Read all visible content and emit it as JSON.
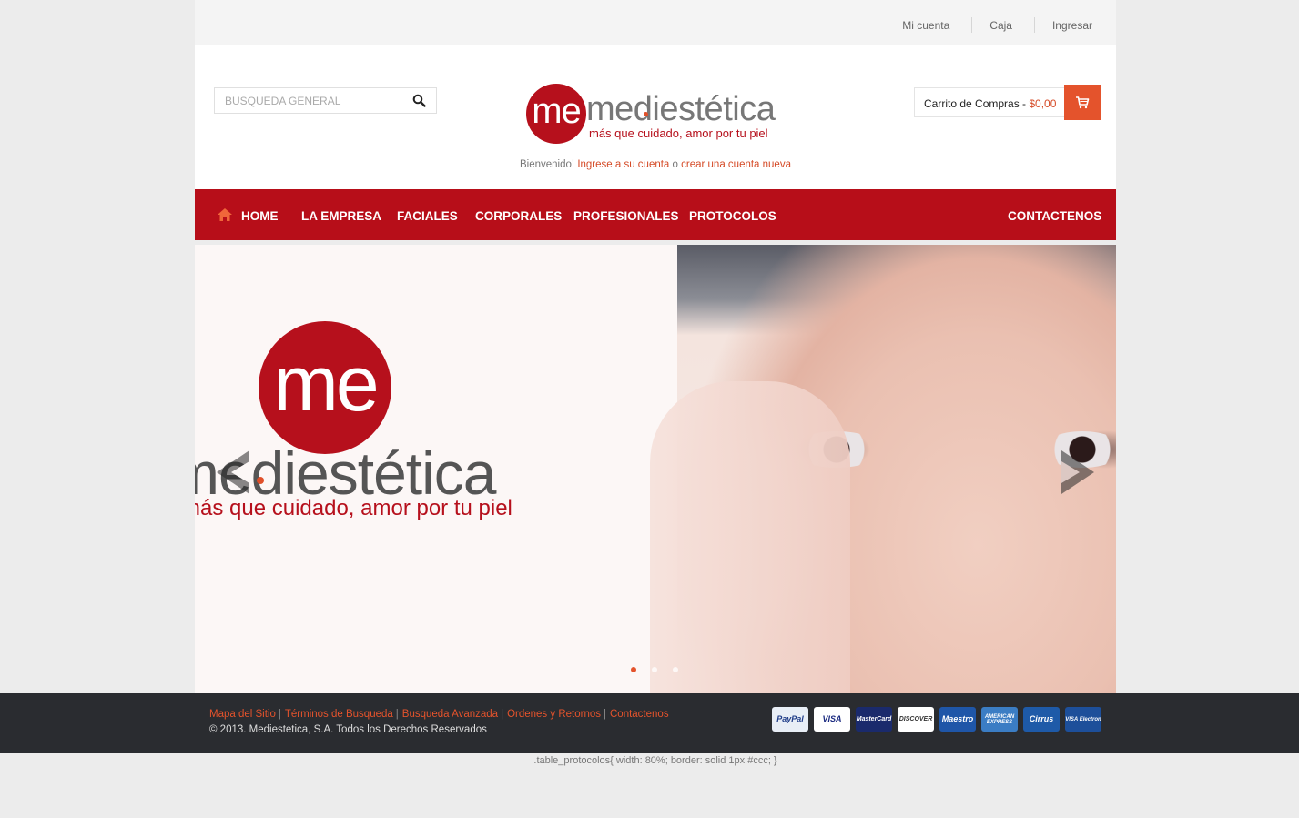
{
  "topbar": {
    "links": [
      "Mi cuenta",
      "Caja",
      "Ingresar"
    ]
  },
  "search": {
    "placeholder": "BUSQUEDA GENERAL"
  },
  "logo": {
    "mark": "me",
    "name": "mediestética",
    "tagline": "más que cuidado, amor por tu piel"
  },
  "welcome": {
    "prefix": "Bienvenido!",
    "login_link": "Ingrese a su cuenta",
    "or": "o",
    "register_link": "crear una cuenta nueva"
  },
  "cart": {
    "label": "Carrito de Compras -",
    "amount": "$0,00"
  },
  "nav": {
    "items": [
      "HOME",
      "LA EMPRESA",
      "FACIALES",
      "CORPORALES",
      "PROFESIONALES",
      "PROTOCOLOS",
      "CONTACTENOS"
    ]
  },
  "slider": {
    "logo_mark": "me",
    "logo_name": "mediestética",
    "logo_tagline": "más que cuidado, amor por tu piel",
    "slides": 3,
    "active_slide": 1
  },
  "footer": {
    "links": [
      "Mapa del Sitio",
      "Términos de Busqueda",
      "Busqueda Avanzada",
      "Ordenes y Retornos",
      "Contactenos"
    ],
    "copyright": "© 2013. Mediestetica, S.A. Todos los Derechos Reservados",
    "payment_cards": [
      {
        "name": "PayPal",
        "bg": "#e8eef6",
        "fg": "#1f3c88"
      },
      {
        "name": "VISA",
        "bg": "#ffffff",
        "fg": "#1a2a80"
      },
      {
        "name": "MasterCard",
        "bg": "#1a2a6c",
        "fg": "#ffffff"
      },
      {
        "name": "DISCOVER",
        "bg": "#ffffff",
        "fg": "#333333"
      },
      {
        "name": "Maestro",
        "bg": "#1f56a8",
        "fg": "#ffffff"
      },
      {
        "name": "AMERICAN EXPRESS",
        "bg": "#3b7dc4",
        "fg": "#ffffff"
      },
      {
        "name": "Cirrus",
        "bg": "#1e5aa8",
        "fg": "#ffffff"
      },
      {
        "name": "VISA Electron",
        "bg": "#1d4f9a",
        "fg": "#ffffff"
      }
    ]
  },
  "stray_css_text": ".table_protocolos{ width: 80%; border: solid 1px #ccc; }",
  "colors": {
    "brand_red": "#b70e19",
    "accent_orange": "#e4532c",
    "footer_bg": "#2a2c30"
  }
}
